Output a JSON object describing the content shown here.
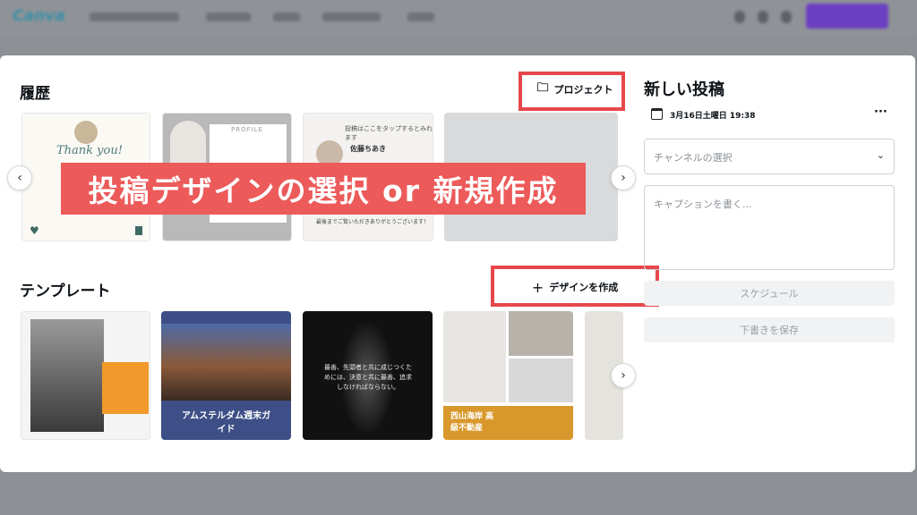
{
  "topbar": {
    "logo": "Canva"
  },
  "history": {
    "title": "履歴",
    "project_button": "プロジェクト",
    "cards": [
      {
        "heading": "Thank you!"
      },
      {
        "heading": "PROFILE"
      },
      {
        "heading": "投稿はここをタップするとみれます",
        "name": "佐藤ちあき",
        "footer": "最後までご覧いただきありがとうございます！"
      },
      {
        "heading": ""
      }
    ]
  },
  "banner": {
    "text": "投稿デザインの選択 or 新規作成",
    "color": "#ec5a5a"
  },
  "templates": {
    "title": "テンプレート",
    "create_button": "デザインを作成",
    "cards": [
      {
        "title": ""
      },
      {
        "title": "アムステルダム週末ガイド"
      },
      {
        "title": "最善、先頭者と共に成じつくためには、決意と共に最善、追求しなければならない。"
      },
      {
        "title": "西山海岸 高級不動産"
      },
      {
        "title": ""
      }
    ]
  },
  "new_post": {
    "title": "新しい投稿",
    "datetime": "3月16日土曜日 19:38",
    "channel_placeholder": "チャンネルの選択",
    "caption_placeholder": "キャプションを書く...",
    "schedule_button": "スケジュール",
    "save_draft_button": "下書きを保存"
  },
  "colors": {
    "highlight": "#e6474c",
    "accent": "#6b3fc2"
  }
}
